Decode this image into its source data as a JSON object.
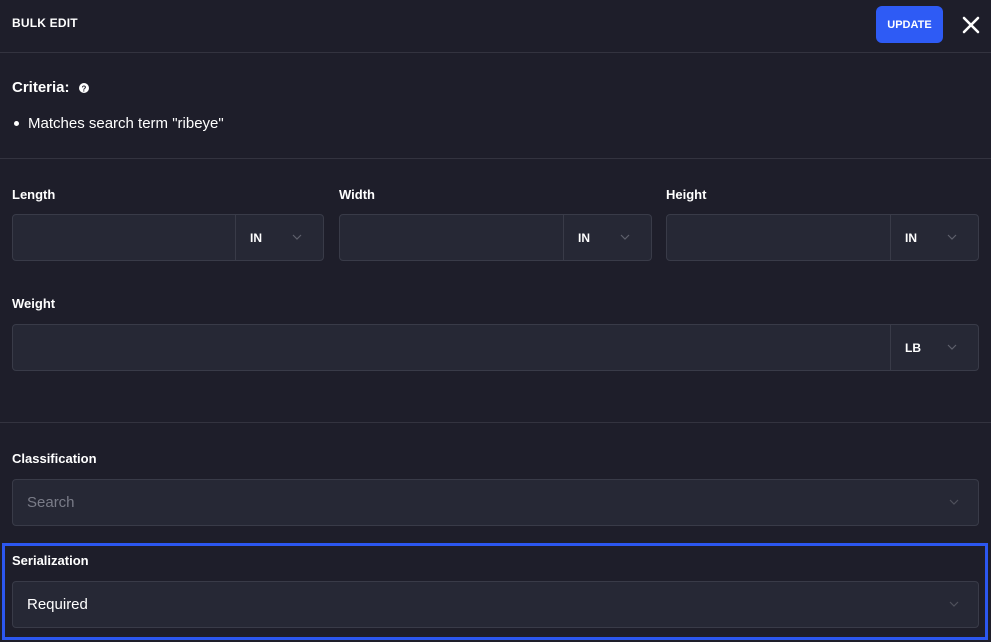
{
  "header": {
    "title": "BULK EDIT",
    "update_label": "UPDATE"
  },
  "criteria": {
    "title": "Criteria:",
    "items": [
      "Matches search term \"ribeye\""
    ]
  },
  "dimensions": {
    "length": {
      "label": "Length",
      "value": "",
      "unit": "IN"
    },
    "width": {
      "label": "Width",
      "value": "",
      "unit": "IN"
    },
    "height": {
      "label": "Height",
      "value": "",
      "unit": "IN"
    }
  },
  "weight": {
    "label": "Weight",
    "value": "",
    "unit": "LB"
  },
  "classification": {
    "label": "Classification",
    "placeholder": "Search"
  },
  "serialization": {
    "label": "Serialization",
    "value": "Required"
  },
  "colors": {
    "accent": "#2e5bf5",
    "background": "#1e1e2a",
    "field": "#262835"
  }
}
